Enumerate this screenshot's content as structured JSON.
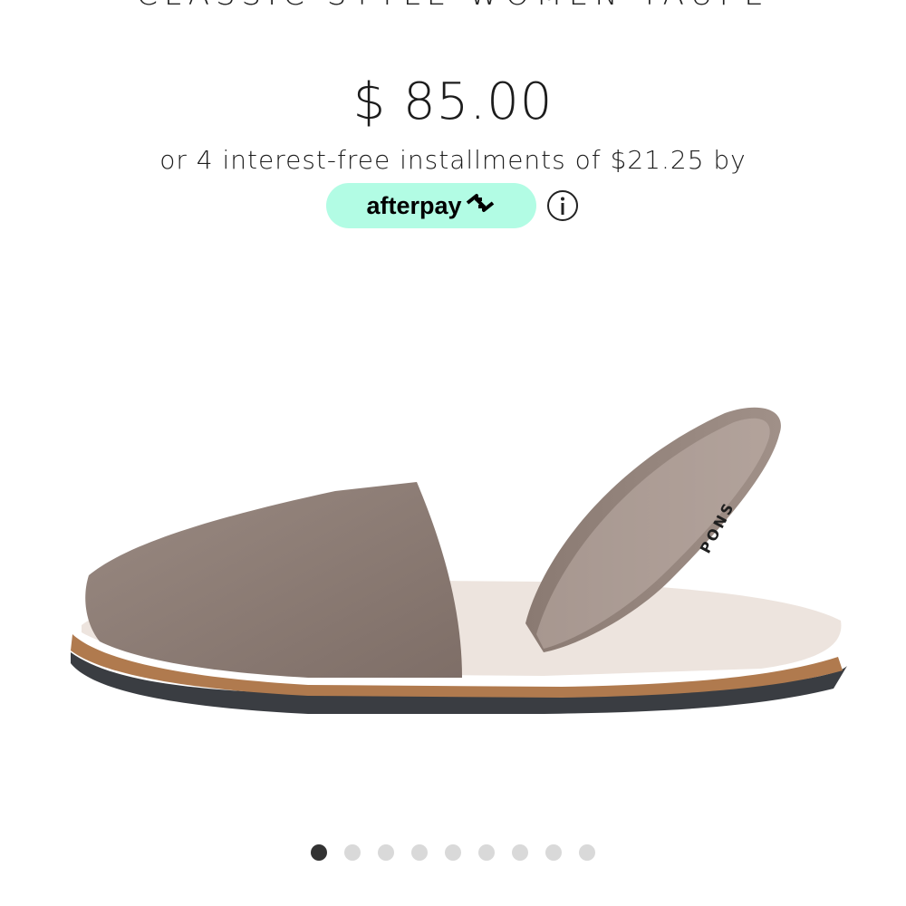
{
  "product": {
    "title": "CLASSIC STYLE WOMEN TAUPE",
    "price": "$ 85.00",
    "installments_text": "or 4 interest-free installments of $21.25 by",
    "afterpay_label": "afterpay",
    "image_brand_text": "PONS"
  },
  "icons": {
    "afterpay_logo": "afterpay-arrows-icon",
    "info": "info-icon"
  },
  "carousel": {
    "total_slides": 9,
    "active_index": 0
  },
  "colors": {
    "afterpay_mint": "#b2fce4",
    "dot_active": "#333333",
    "dot_inactive": "#d9d9d9"
  }
}
